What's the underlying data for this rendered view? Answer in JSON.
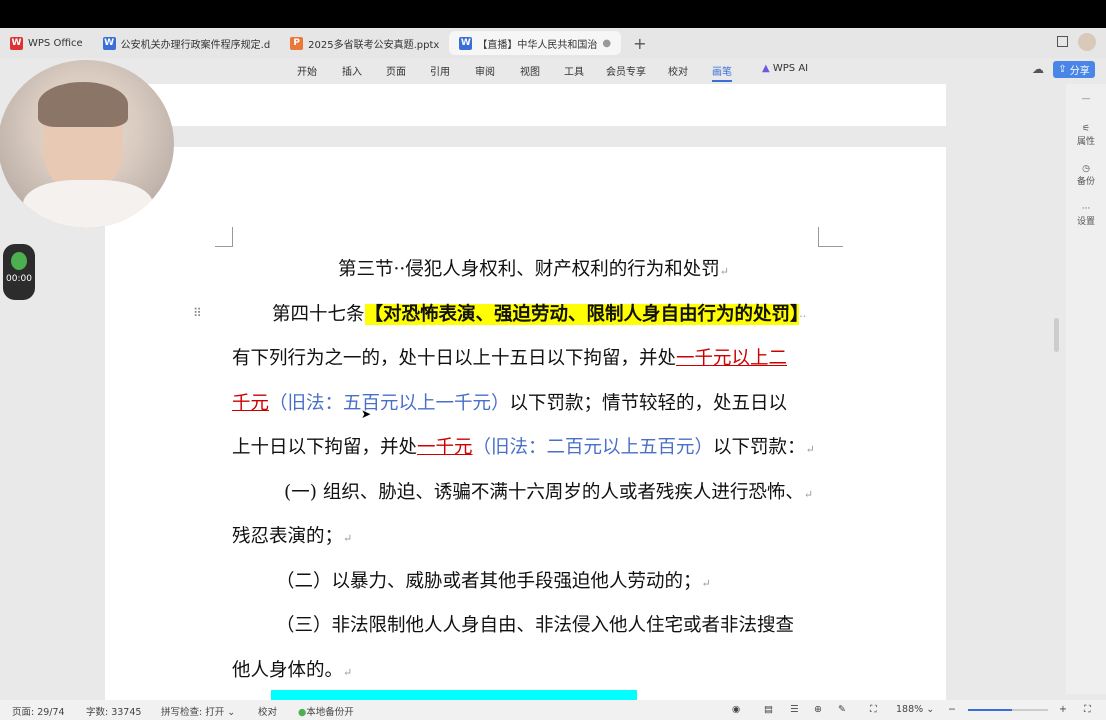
{
  "tabs": [
    {
      "label": "WPS Office",
      "icon": "wps-logo"
    },
    {
      "label": "公安机关办理行政案件程序规定.d",
      "icon": "word-icon"
    },
    {
      "label": "2025多省联考公安真题.pptx",
      "icon": "ppt-icon"
    },
    {
      "label": "【直播】中华人民共和国治",
      "icon": "word-icon",
      "active": true
    }
  ],
  "menu": [
    "开始",
    "插入",
    "页面",
    "引用",
    "审阅",
    "视图",
    "工具",
    "会员专享",
    "校对",
    "画笔",
    "WPS AI"
  ],
  "active_menu": "画笔",
  "share_label": "分享",
  "right_panel": [
    "属性",
    "备份",
    "设置"
  ],
  "timer": "00:00",
  "document": {
    "title": "第三节··侵犯人身权利、财产权利的行为和处罚",
    "article": "第四十七条",
    "article_heading": "【对恐怖表演、强迫劳动、限制人身自由行为的处罚】",
    "l2a": "有下列行为之一的，处十日以上十五日以下拘留，并处",
    "l2red": "一千元以上二",
    "l3red": "千元",
    "l3blue": "（旧法：五百元以上一千元）",
    "l3b": "以下罚款；情节较轻的，处五日以",
    "l4a": "上十日以下拘留，并处",
    "l4red": "一千元",
    "l4blue": "（旧法：二百元以上五百元）",
    "l4b": "以下罚款：",
    "item1a": "(一) 组织、胁迫、诱骗不满十六周岁的人或者残疾人进行恐怖、",
    "item1b": "残忍表演的；",
    "item2": "（二）以暴力、威胁或者其他手段强迫他人劳动的；",
    "item3a": "（三）非法限制他人人身自由、非法侵入他人住宅或者非法搜查",
    "item3b": "他人身体的。"
  },
  "status": {
    "page": "页面: 29/74",
    "words": "字数: 33745",
    "spell": "拼写检查: 打开",
    "proof": "校对",
    "backup": "本地备份开",
    "zoom": "188%"
  },
  "colors": {
    "accent": "#3a6fd8",
    "highlight": "#ffff00",
    "red": "#cc0000",
    "blue": "#4a6fc8"
  }
}
